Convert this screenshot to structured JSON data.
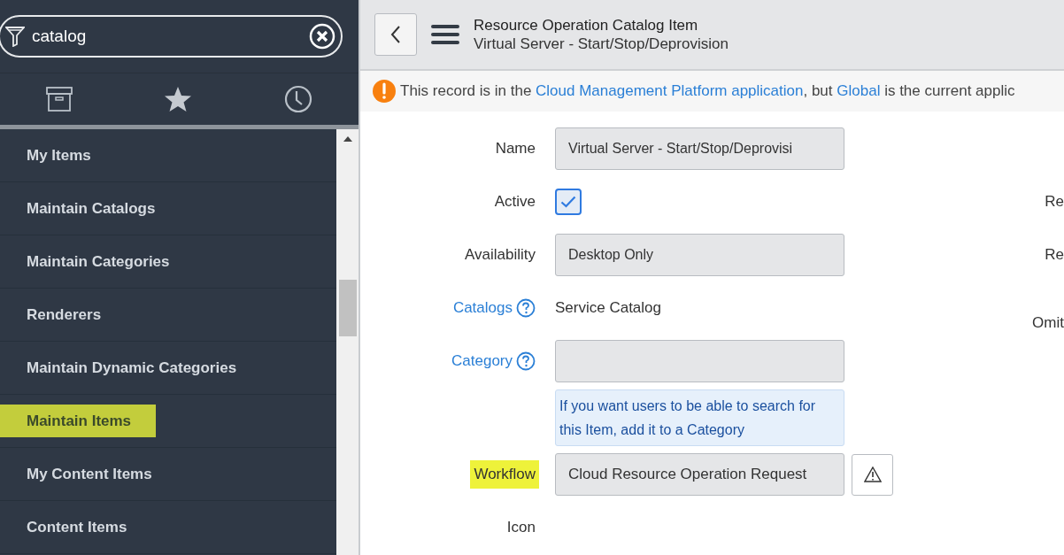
{
  "search": {
    "value": "catalog"
  },
  "nav_items": [
    {
      "label": "My Items",
      "highlighted": false
    },
    {
      "label": "Maintain Catalogs",
      "highlighted": false
    },
    {
      "label": "Maintain Categories",
      "highlighted": false
    },
    {
      "label": "Renderers",
      "highlighted": false
    },
    {
      "label": "Maintain Dynamic Categories",
      "highlighted": false
    },
    {
      "label": "Maintain Items",
      "highlighted": true
    },
    {
      "label": "My Content Items",
      "highlighted": false
    },
    {
      "label": "Content Items",
      "highlighted": false
    }
  ],
  "header": {
    "title": "Resource Operation Catalog Item",
    "subtitle": "Virtual Server - Start/Stop/Deprovision"
  },
  "notice": {
    "parts": [
      {
        "text": "This record is in the ",
        "kind": "text"
      },
      {
        "text": "Cloud Management Platform application",
        "kind": "link"
      },
      {
        "text": ", but ",
        "kind": "text"
      },
      {
        "text": "Global",
        "kind": "link"
      },
      {
        "text": " is the current applic",
        "kind": "text"
      }
    ]
  },
  "form_fields": [
    {
      "label": "Name",
      "kind": "text",
      "value": "Virtual Server - Start/Stop/Deprovisi",
      "link": false,
      "help": false,
      "highlighted": false
    },
    {
      "label": "Active",
      "kind": "checkbox",
      "checked": true,
      "link": false,
      "help": false,
      "highlighted": false,
      "right_label": "Re"
    },
    {
      "label": "Availability",
      "kind": "text",
      "value": "Desktop Only",
      "link": false,
      "help": false,
      "highlighted": false,
      "right_label": "Re"
    },
    {
      "label": "Catalogs",
      "kind": "plain",
      "value": "Service Catalog",
      "link": true,
      "help": true,
      "highlighted": false,
      "right_label": "Omit"
    },
    {
      "label": "Category",
      "kind": "text",
      "link": true,
      "help": true,
      "highlighted": false,
      "hint": "If you want users to be able to search for this Item, add it to a Category"
    },
    {
      "label": "Workflow",
      "kind": "reference",
      "value": "Cloud Resource Operation Request",
      "link": false,
      "help": false,
      "highlighted": true
    },
    {
      "label": "Icon",
      "kind": "empty",
      "link": false,
      "help": false,
      "highlighted": false
    }
  ]
}
